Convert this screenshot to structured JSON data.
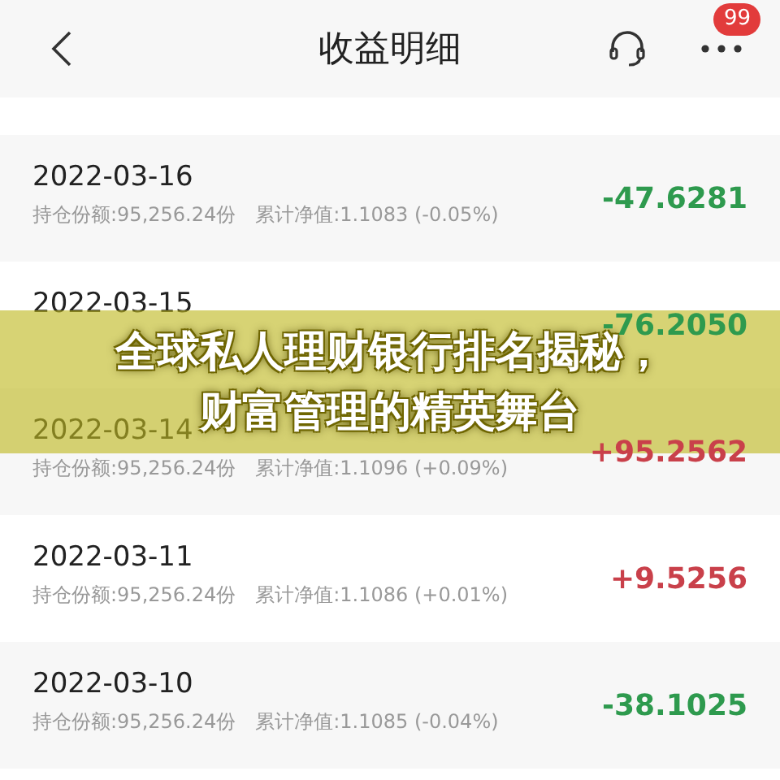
{
  "header": {
    "title": "收益明细",
    "badge": "99"
  },
  "rows": [
    {
      "date": "2022-03-16",
      "detail": "持仓份额:95,256.24份　累计净值:1.1083 (-0.05%)",
      "amount": "-47.6281",
      "color": "#2e9a4e"
    },
    {
      "date": "2022-03-15",
      "amount": "-76.2050",
      "color": "#2e9a4e"
    },
    {
      "date": "2022-03-14",
      "detail": "持仓份额:95,256.24份　累计净值:1.1096 (+0.09%)",
      "amount": "+95.2562",
      "color": "#c9404a"
    },
    {
      "date": "2022-03-11",
      "detail": "持仓份额:95,256.24份　累计净值:1.1086 (+0.01%)",
      "amount": "+9.5256",
      "color": "#c9404a"
    },
    {
      "date": "2022-03-10",
      "detail": "持仓份额:95,256.24份　累计净值:1.1085 (-0.04%)",
      "amount": "-38.1025",
      "color": "#2e9a4e"
    }
  ],
  "banner": {
    "lines": [
      "全球私人理财银行排名揭秘，",
      "财富管理的精英舞台"
    ]
  }
}
